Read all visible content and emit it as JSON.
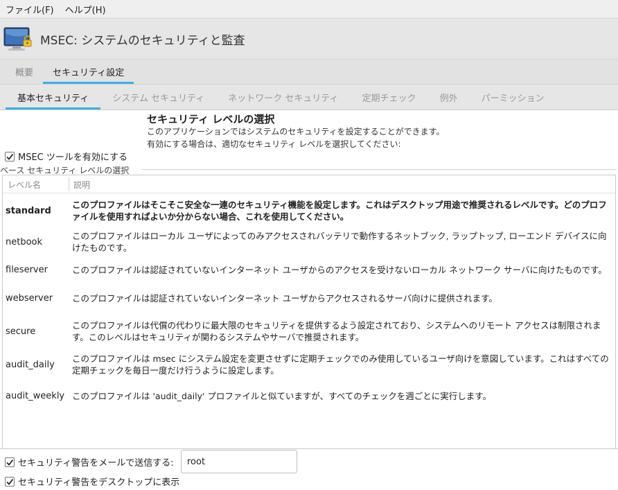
{
  "menubar": {
    "items": [
      {
        "label": "ファイル(F)"
      },
      {
        "label": "ヘルプ(H)"
      }
    ]
  },
  "header": {
    "title": "MSEC: システムのセキュリティと監査",
    "icon": "monitor-lock-icon"
  },
  "main_tabs": [
    {
      "label": "概要",
      "active": false
    },
    {
      "label": "セキュリティ設定",
      "active": true
    }
  ],
  "sub_tabs": [
    {
      "label": "基本セキュリティ",
      "active": true
    },
    {
      "label": "システム セキュリティ",
      "active": false
    },
    {
      "label": "ネットワーク セキュリティ",
      "active": false
    },
    {
      "label": "定期チェック",
      "active": false
    },
    {
      "label": "例外",
      "active": false
    },
    {
      "label": "パーミッション",
      "active": false
    }
  ],
  "section": {
    "heading": "セキュリティ レベルの選択",
    "desc1": "このアプリケーションではシステムのセキュリティを設定することができます。",
    "desc2": "有効にする場合は、適切なセキュリティ レベルを選択してください:"
  },
  "enable_msec": {
    "label": "MSEC ツールを有効にする",
    "checked": true
  },
  "level_group": {
    "title": "ベース セキュリティ レベルの選択"
  },
  "table": {
    "headers": [
      "レベル名",
      "説明"
    ],
    "rows": [
      {
        "name": "standard",
        "desc": "このプロファイルはそこそこ安全な一連のセキュリティ機能を設定します。これはデスクトップ用途で推奨されるレベルです。どのプロファイルを使用すればよいか分からない場合、これを使用してください。",
        "selected": true
      },
      {
        "name": "netbook",
        "desc": "このプロファイルはローカル ユーザによってのみアクセスされバッテリで動作するネットブック, ラップトップ, ローエンド デバイスに向けたものです。",
        "selected": false
      },
      {
        "name": "fileserver",
        "desc": "このプロファイルは認証されていないインターネット ユーザからのアクセスを受けないローカル ネットワーク サーバに向けたものです。",
        "selected": false
      },
      {
        "name": "webserver",
        "desc": "このプロファイルは認証されていないインターネット ユーザからアクセスされるサーバ向けに提供されます。",
        "selected": false
      },
      {
        "name": "secure",
        "desc": "このプロファイルは代償の代わりに最大限のセキュリティを提供するよう設定されており、システムへのリモート アクセスは制限されます。このレベルはセキュリティが関わるシステムやサーバで推奨されます。",
        "selected": false
      },
      {
        "name": "audit_daily",
        "desc": "このプロファイルは msec にシステム設定を変更させずに定期チェックでのみ使用しているユーザ向けを意図しています。これはすべての定期チェックを毎日一度だけ行うように設定します。",
        "selected": false
      },
      {
        "name": "audit_weekly",
        "desc": "このプロファイルは 'audit_daily' プロファイルと似ていますが、すべてのチェックを週ごとに実行します。",
        "selected": false
      }
    ]
  },
  "email_alert": {
    "label": "セキュリティ警告をメールで送信する:",
    "checked": true,
    "value": "root"
  },
  "desktop_alert": {
    "label": "セキュリティ警告をデスクトップに表示",
    "checked": true
  },
  "colors": {
    "accent": "#3daee9",
    "background": "#efefef"
  }
}
